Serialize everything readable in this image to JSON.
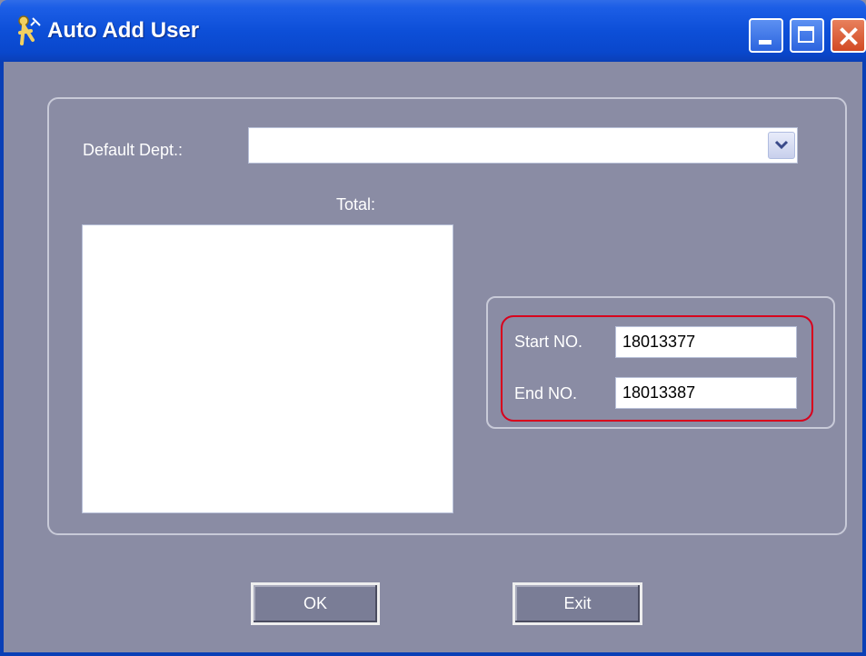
{
  "window": {
    "title": "Auto Add User",
    "icon": "key-user-icon",
    "controls": {
      "minimize": "minimize-icon",
      "maximize": "maximize-icon",
      "close": "close-icon"
    }
  },
  "form": {
    "default_dept_label": "Default Dept.:",
    "default_dept_value": "",
    "total_label": "Total:",
    "start_no_label": "Start NO.",
    "start_no_value": "18013377",
    "end_no_label": "End NO.",
    "end_no_value": "18013387"
  },
  "buttons": {
    "ok_label": "OK",
    "exit_label": "Exit"
  },
  "colors": {
    "background": "#8a8ca4",
    "titlebar": "#0d4fd8",
    "highlight": "#d8001c"
  }
}
